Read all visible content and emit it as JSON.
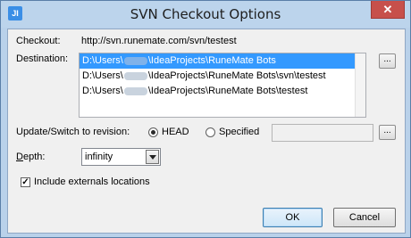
{
  "window": {
    "title": "SVN Checkout Options",
    "app_icon_text": "JI",
    "close_glyph": "✕"
  },
  "checkout": {
    "label": "Checkout:",
    "url": "http://svn.runemate.com/svn/testest"
  },
  "destination": {
    "label": "Destination:",
    "items": [
      {
        "prefix": "D:\\Users\\",
        "suffix": "\\IdeaProjects\\RuneMate Bots",
        "selected": true
      },
      {
        "prefix": "D:\\Users\\",
        "suffix": "\\IdeaProjects\\RuneMate Bots\\svn\\testest",
        "selected": false
      },
      {
        "prefix": "D:\\Users\\",
        "suffix": "\\IdeaProjects\\RuneMate Bots\\testest",
        "selected": false
      }
    ],
    "browse_label": "..."
  },
  "revision": {
    "label": "Update/Switch to revision:",
    "head_label": "HEAD",
    "specified_label": "Specified",
    "specified_value": "",
    "browse_label": "..."
  },
  "depth": {
    "label_underlined": "D",
    "label_rest": "epth:",
    "value": "infinity"
  },
  "externals": {
    "label": "Include externals locations",
    "checked_glyph": "✓"
  },
  "buttons": {
    "ok": "OK",
    "cancel": "Cancel"
  }
}
